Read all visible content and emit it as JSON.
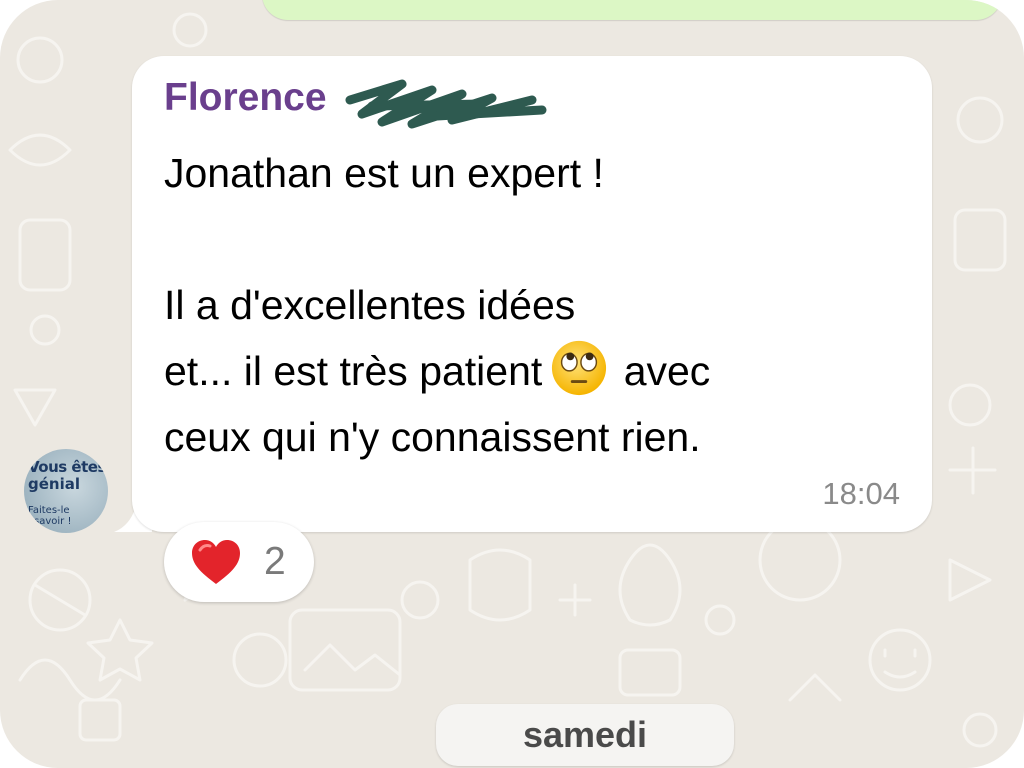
{
  "message": {
    "sender": "Florence",
    "lines": [
      "Jonathan est un expert !",
      "",
      "Il a d'excellentes idées",
      "et... il est très patient",
      "avec",
      "ceux qui n'y connaissent rien."
    ],
    "emoji": "face-with-rolling-eyes",
    "time": "18:04"
  },
  "avatar": {
    "lines": [
      "Vous êtes",
      "génial",
      "Faites-le",
      "savoir !"
    ]
  },
  "reaction": {
    "emoji": "red-heart",
    "count": "2"
  },
  "date_separator": "samedi",
  "colors": {
    "background": "#ece8e1",
    "sender_name": "#6a3f8d",
    "outgoing_bubble": "#dcf7c5",
    "bubble": "#ffffff",
    "timestamp": "#8a8a8a"
  }
}
